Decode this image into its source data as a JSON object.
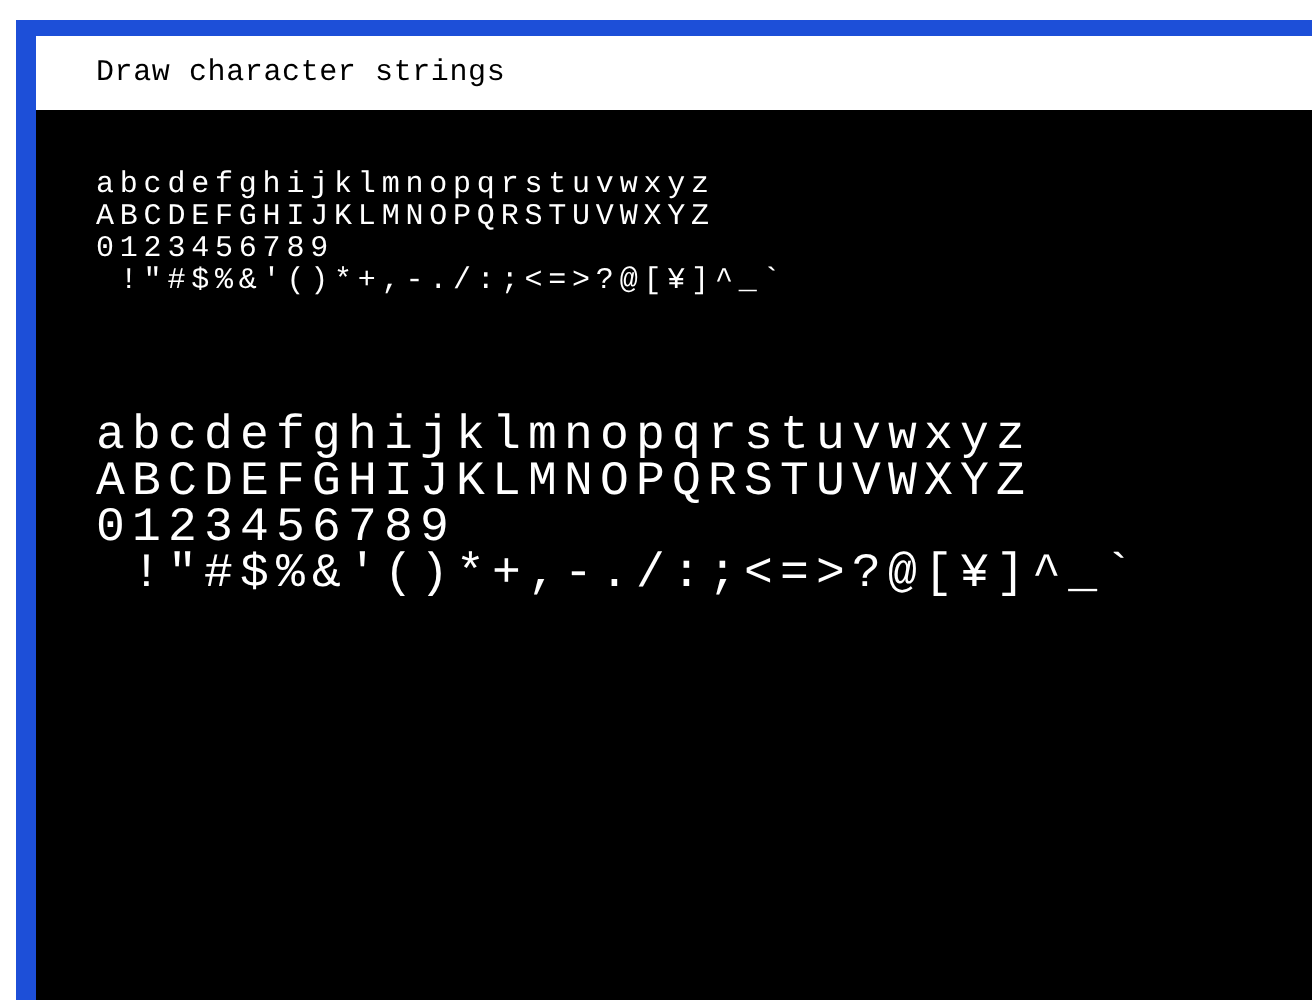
{
  "window": {
    "title": "Draw character strings"
  },
  "text_blocks": [
    {
      "kind": "small",
      "lines": [
        "abcdefghijklmnopqrstuvwxyz",
        "ABCDEFGHIJKLMNOPQRSTUVWXYZ",
        "0123456789",
        " !\"#$%&'()*+,-./:;<=>?@[¥]^_`"
      ]
    },
    {
      "kind": "large",
      "lines": [
        "abcdefghijklmnopqrstuvwxyz",
        "ABCDEFGHIJKLMNOPQRSTUVWXYZ",
        "0123456789",
        " !\"#$%&'()*+,-./:;<=>?@[¥]^_`"
      ]
    }
  ]
}
